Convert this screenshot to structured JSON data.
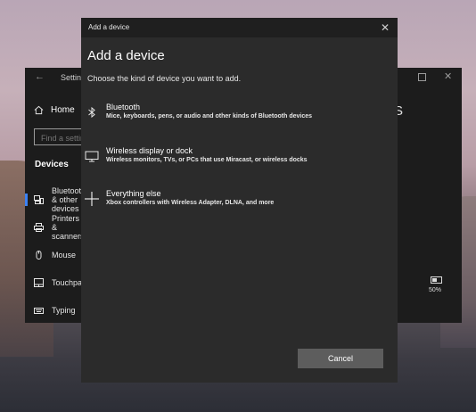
{
  "settings": {
    "back_glyph": "←",
    "title": "Settings",
    "close_glyph": "✕",
    "home_label": "Home",
    "search_placeholder": "Find a setting",
    "section_heading": "Devices",
    "nav_items": [
      {
        "label": "Bluetooth & other devices",
        "icon": "bluetooth-devices-icon",
        "active": true
      },
      {
        "label": "Printers & scanners",
        "icon": "printer-icon",
        "active": false
      },
      {
        "label": "Mouse",
        "icon": "mouse-icon",
        "active": false
      },
      {
        "label": "Touchpad",
        "icon": "touchpad-icon",
        "active": false
      },
      {
        "label": "Typing",
        "icon": "keyboard-icon",
        "active": false
      }
    ],
    "header_fragment": "S",
    "battery_percent": "50%",
    "accent_color": "#3b82f6"
  },
  "dialog": {
    "window_title": "Add a device",
    "close_glyph": "✕",
    "heading": "Add a device",
    "subheading": "Choose the kind of device you want to add.",
    "options": [
      {
        "title": "Bluetooth",
        "description": "Mice, keyboards, pens, or audio and other kinds of Bluetooth devices",
        "icon": "bluetooth-icon"
      },
      {
        "title": "Wireless display or dock",
        "description": "Wireless monitors, TVs, or PCs that use Miracast, or wireless docks",
        "icon": "monitor-icon"
      },
      {
        "title": "Everything else",
        "description": "Xbox controllers with Wireless Adapter, DLNA, and more",
        "icon": "plus-icon"
      }
    ],
    "cancel_label": "Cancel"
  }
}
